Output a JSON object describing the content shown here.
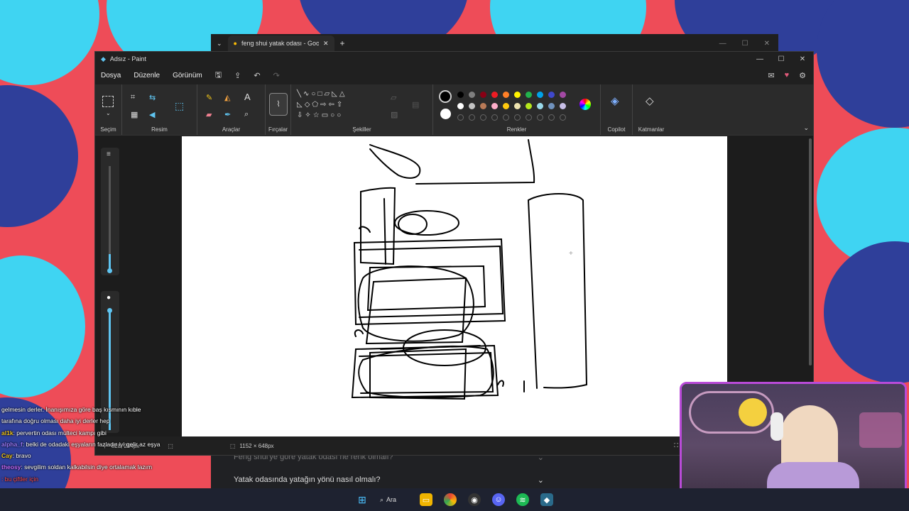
{
  "browser": {
    "tab_title": "feng shui yatak odası - Google",
    "new_tab": "+",
    "faq_1": "Feng shui'ye göre yatak odası ne renk olmalı?",
    "faq_2": "Yatak odasında yatağın yönü nasıl olmalı?"
  },
  "paint": {
    "title": "Adsız - Paint",
    "menu": [
      "Dosya",
      "Düzenle",
      "Görünüm"
    ],
    "groups": {
      "selection": "Seçim",
      "image": "Resim",
      "tools": "Araçlar",
      "brushes": "Fırçalar",
      "shapes": "Şekiller",
      "colors": "Renkler",
      "copilot": "Copilot",
      "layers": "Katmanlar"
    },
    "palette_row1": [
      "#000000",
      "#7f7f7f",
      "#880015",
      "#ed1c24",
      "#ff7f27",
      "#fff200",
      "#22b14c",
      "#00a2e8",
      "#3f48cc",
      "#a349a4"
    ],
    "palette_row2": [
      "#ffffff",
      "#c3c3c3",
      "#b97a57",
      "#ffaec9",
      "#ffc90e",
      "#efe4b0",
      "#b5e61d",
      "#99d9ea",
      "#7092be",
      "#c8bfe7"
    ],
    "status": {
      "cursor": "820, 254px",
      "canvas_size": "1152 × 648px"
    }
  },
  "chat": [
    {
      "user": "",
      "text": "gelmesin derler. İnanışımıza göre baş kısmının kıble tarafına doğru olması daha iyi derler hep",
      "color": "#ffffff"
    },
    {
      "user": "al1k",
      "text": ": pervertin odası mülteci kampı gibi",
      "color": "#f0c419"
    },
    {
      "user": "alpha_f",
      "text": ": belki de odadaki eşyaların fazladır iyi gelir az eşya",
      "color": "#9b7bff"
    },
    {
      "user": "Cay",
      "text": ": bravo",
      "color": "#f0c419"
    },
    {
      "user": "theosy",
      "text": ": sevgilim soldan kalkabilsin diye ortalamak lazım",
      "color": "#c46bff"
    },
    {
      "user": "",
      "text": ": bu çiftler için",
      "color": "#ff4d4d"
    }
  ],
  "taskbar": {
    "search_label": "Ara"
  }
}
